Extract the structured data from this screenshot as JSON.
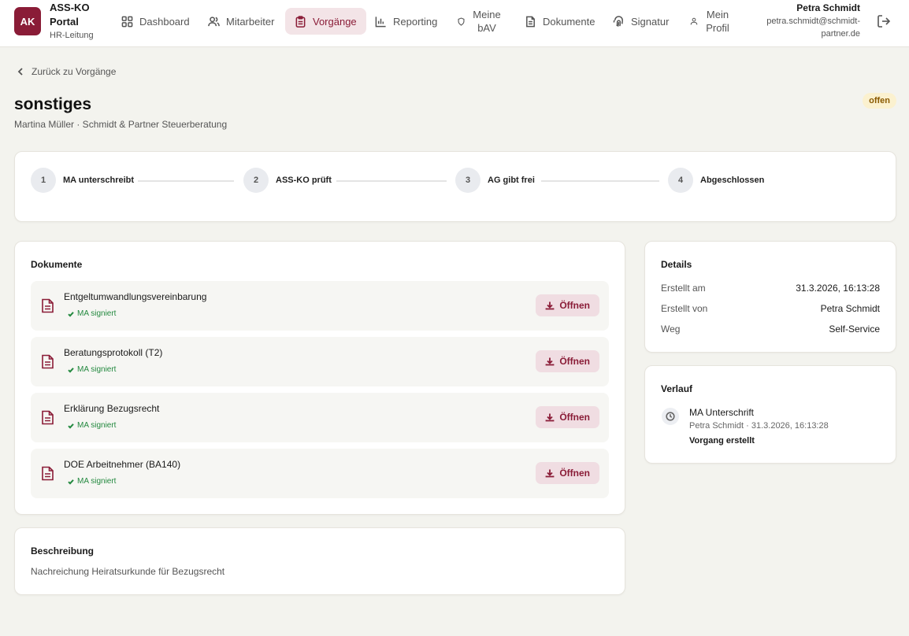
{
  "app": {
    "logo_text": "AK",
    "name": "ASS-KO Portal",
    "role": "HR-Leitung"
  },
  "nav": {
    "items": [
      {
        "label": "Dashboard",
        "icon": "grid-icon"
      },
      {
        "label": "Mitarbeiter",
        "icon": "users-icon"
      },
      {
        "label": "Vorgänge",
        "icon": "clipboard-icon",
        "active": true
      },
      {
        "label": "Reporting",
        "icon": "bar-chart-icon"
      },
      {
        "label": "Meine bAV",
        "icon": "shield-icon"
      },
      {
        "label": "Dokumente",
        "icon": "document-icon"
      },
      {
        "label": "Signatur",
        "icon": "fingerprint-icon"
      },
      {
        "label": "Mein Profil",
        "icon": "user-icon"
      }
    ]
  },
  "user": {
    "name": "Petra Schmidt",
    "email": "petra.schmidt@schmidt-partner.de"
  },
  "page": {
    "back_label": "Zurück zu Vorgänge",
    "title": "sonstiges",
    "subtitle": "Martina Müller · Schmidt & Partner Steuerberatung",
    "status": "offen"
  },
  "steps": [
    {
      "num": "1",
      "label": "MA unterschreibt"
    },
    {
      "num": "2",
      "label": "ASS-KO prüft"
    },
    {
      "num": "3",
      "label": "AG gibt frei"
    },
    {
      "num": "4",
      "label": "Abgeschlossen"
    }
  ],
  "documents": {
    "title": "Dokumente",
    "open_label": "Öffnen",
    "items": [
      {
        "name": "Entgeltumwandlungsvereinbarung",
        "status": "MA signiert"
      },
      {
        "name": "Beratungsprotokoll (T2)",
        "status": "MA signiert"
      },
      {
        "name": "Erklärung Bezugsrecht",
        "status": "MA signiert"
      },
      {
        "name": "DOE Arbeitnehmer (BA140)",
        "status": "MA signiert"
      }
    ]
  },
  "description": {
    "title": "Beschreibung",
    "text": "Nachreichung Heiratsurkunde für Bezugsrecht"
  },
  "details": {
    "title": "Details",
    "rows": [
      {
        "key": "Erstellt am",
        "value": "31.3.2026, 16:13:28"
      },
      {
        "key": "Erstellt von",
        "value": "Petra Schmidt"
      },
      {
        "key": "Weg",
        "value": "Self-Service"
      }
    ]
  },
  "history": {
    "title": "Verlauf",
    "entries": [
      {
        "title": "MA Unterschrift",
        "meta": "Petra Schmidt · 31.3.2026, 16:13:28",
        "note": "Vorgang erstellt"
      }
    ]
  },
  "colors": {
    "brand": "#8a1c37",
    "background": "#f3f3ee",
    "success": "#23893f",
    "badge_bg": "#fbf1cf"
  }
}
